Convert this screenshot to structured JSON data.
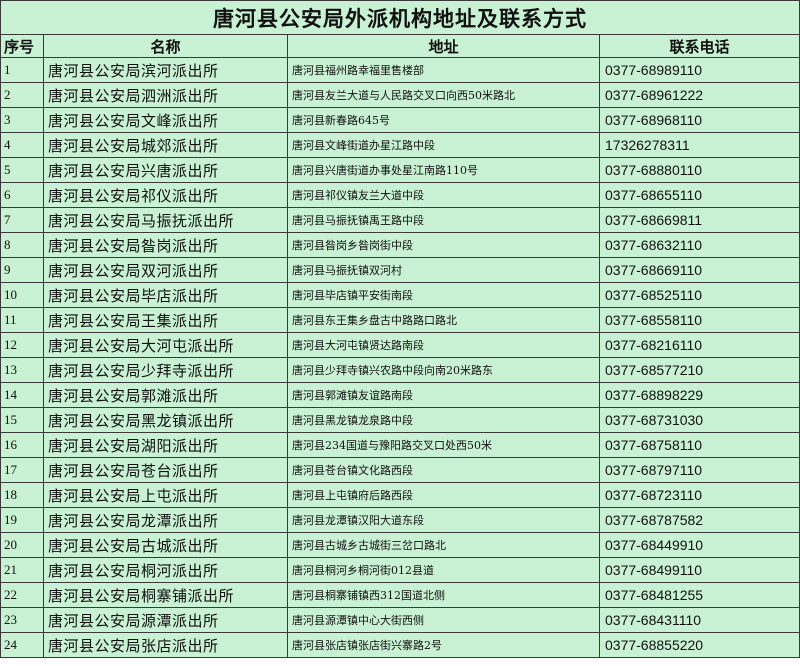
{
  "title": "唐河县公安局外派机构地址及联系方式",
  "headers": {
    "no": "序号",
    "name": "名称",
    "address": "地址",
    "phone": "联系电话"
  },
  "rows": [
    {
      "no": "1",
      "name": "唐河县公安局滨河派出所",
      "address": "唐河县福州路幸福里售楼部",
      "phone": "0377-68989110"
    },
    {
      "no": "2",
      "name": "唐河县公安局泗洲派出所",
      "address": "唐河县友兰大道与人民路交叉口向西50米路北",
      "phone": "0377-68961222"
    },
    {
      "no": "3",
      "name": "唐河县公安局文峰派出所",
      "address": "唐河县新春路645号",
      "phone": "0377-68968110"
    },
    {
      "no": "4",
      "name": "唐河县公安局城郊派出所",
      "address": "唐河县文峰街道办星江路中段",
      "phone": "17326278311"
    },
    {
      "no": "5",
      "name": "唐河县公安局兴唐派出所",
      "address": "唐河县兴唐街道办事处星江南路110号",
      "phone": "0377-68880110"
    },
    {
      "no": "6",
      "name": "唐河县公安局祁仪派出所",
      "address": "唐河县祁仪镇友兰大道中段",
      "phone": "0377-68655110"
    },
    {
      "no": "7",
      "name": "唐河县公安局马振抚派出所",
      "address": "唐河县马振抚镇禹王路中段",
      "phone": "0377-68669811"
    },
    {
      "no": "8",
      "name": "唐河县公安局昝岗派出所",
      "address": "唐河县昝岗乡昝岗街中段",
      "phone": "0377-68632110"
    },
    {
      "no": "9",
      "name": "唐河县公安局双河派出所",
      "address": "唐河县马振抚镇双河村",
      "phone": "0377-68669110"
    },
    {
      "no": "10",
      "name": "唐河县公安局毕店派出所",
      "address": "唐河县毕店镇平安街南段",
      "phone": "0377-68525110"
    },
    {
      "no": "11",
      "name": "唐河县公安局王集派出所",
      "address": "唐河县东王集乡盘古中路路口路北",
      "phone": "0377-68558110"
    },
    {
      "no": "12",
      "name": "唐河县公安局大河屯派出所",
      "address": "唐河县大河屯镇贤达路南段",
      "phone": "0377-68216110"
    },
    {
      "no": "13",
      "name": "唐河县公安局少拜寺派出所",
      "address": "唐河县少拜寺镇兴农路中段向南20米路东",
      "phone": "0377-68577210"
    },
    {
      "no": "14",
      "name": "唐河县公安局郭滩派出所",
      "address": "唐河县郭滩镇友谊路南段",
      "phone": "0377-68898229"
    },
    {
      "no": "15",
      "name": "唐河县公安局黑龙镇派出所",
      "address": "唐河县黑龙镇龙泉路中段",
      "phone": "0377-68731030"
    },
    {
      "no": "16",
      "name": "唐河县公安局湖阳派出所",
      "address": "唐河县234国道与豫阳路交叉口处西50米",
      "phone": "0377-68758110"
    },
    {
      "no": "17",
      "name": "唐河县公安局苍台派出所",
      "address": "唐河县苍台镇文化路西段",
      "phone": "0377-68797110"
    },
    {
      "no": "18",
      "name": "唐河县公安局上屯派出所",
      "address": "唐河县上屯镇府后路西段",
      "phone": "0377-68723110"
    },
    {
      "no": "19",
      "name": "唐河县公安局龙潭派出所",
      "address": "唐河县龙潭镇汉阳大道东段",
      "phone": "0377-68787582"
    },
    {
      "no": "20",
      "name": "唐河县公安局古城派出所",
      "address": "唐河县古城乡古城街三岔口路北",
      "phone": "0377-68449910"
    },
    {
      "no": "21",
      "name": "唐河县公安局桐河派出所",
      "address": "唐河县桐河乡桐河街012县道",
      "phone": "0377-68499110"
    },
    {
      "no": "22",
      "name": "唐河县公安局桐寨铺派出所",
      "address": "唐河县桐寨铺镇西312国道北侧",
      "phone": "0377-68481255"
    },
    {
      "no": "23",
      "name": "唐河县公安局源潭派出所",
      "address": "唐河县源潭镇中心大街西侧",
      "phone": "0377-68431110"
    },
    {
      "no": "24",
      "name": "唐河县公安局张店派出所",
      "address": "唐河县张店镇张店街兴寨路2号",
      "phone": "0377-68855220"
    }
  ]
}
